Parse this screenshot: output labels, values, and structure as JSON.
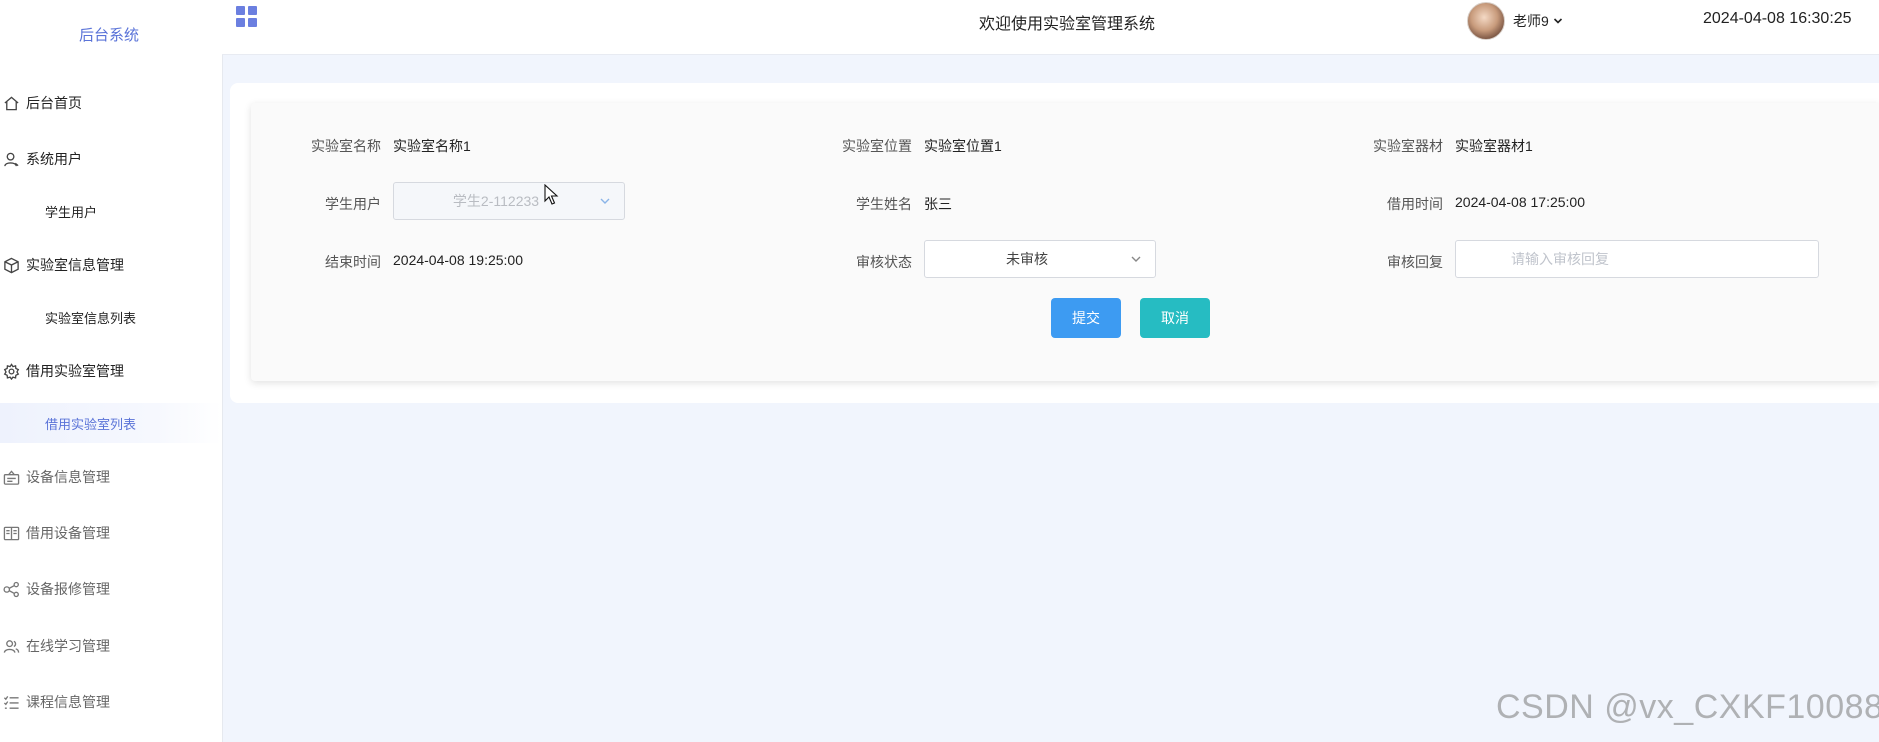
{
  "sidebar": {
    "brand": "后台系统",
    "menu": [
      {
        "label": "后台首页",
        "icon": "home-icon"
      },
      {
        "label": "系统用户",
        "icon": "user-icon"
      },
      {
        "label": "学生用户",
        "sub": true
      },
      {
        "label": "实验室信息管理",
        "icon": "cube-icon"
      },
      {
        "label": "实验室信息列表",
        "sub": true
      },
      {
        "label": "借用实验室管理",
        "icon": "gear-icon"
      },
      {
        "label": "借用实验室列表",
        "sub": true,
        "active": true
      },
      {
        "label": "设备信息管理",
        "icon": "device-icon"
      },
      {
        "label": "借用设备管理",
        "icon": "book-icon"
      },
      {
        "label": "设备报修管理",
        "icon": "share-icon"
      },
      {
        "label": "在线学习管理",
        "icon": "users-icon"
      },
      {
        "label": "课程信息管理",
        "icon": "list-icon"
      }
    ]
  },
  "header": {
    "title": "欢迎使用实验室管理系统",
    "user_name": "老师9",
    "datetime": "2024-04-08 16:30:25"
  },
  "form": {
    "lab_name": {
      "label": "实验室名称",
      "value": "实验室名称1"
    },
    "lab_location": {
      "label": "实验室位置",
      "value": "实验室位置1"
    },
    "lab_equipment": {
      "label": "实验室器材",
      "value": "实验室器材1"
    },
    "student_user": {
      "label": "学生用户",
      "value": "学生2-112233"
    },
    "student_name": {
      "label": "学生姓名",
      "value": "张三"
    },
    "borrow_time": {
      "label": "借用时间",
      "value": "2024-04-08 17:25:00"
    },
    "end_time": {
      "label": "结束时间",
      "value": "2024-04-08 19:25:00"
    },
    "review_status": {
      "label": "审核状态",
      "value": "未审核"
    },
    "review_reply": {
      "label": "审核回复",
      "value": "",
      "placeholder": "请输入审核回复"
    },
    "submit_label": "提交",
    "cancel_label": "取消"
  },
  "watermark": "CSDN @vx_CXKF10088",
  "colors": {
    "accent": "#5a73d8",
    "submit": "#3d9bf2",
    "cancel": "#26bcc2",
    "background": "#f1f5fd"
  }
}
